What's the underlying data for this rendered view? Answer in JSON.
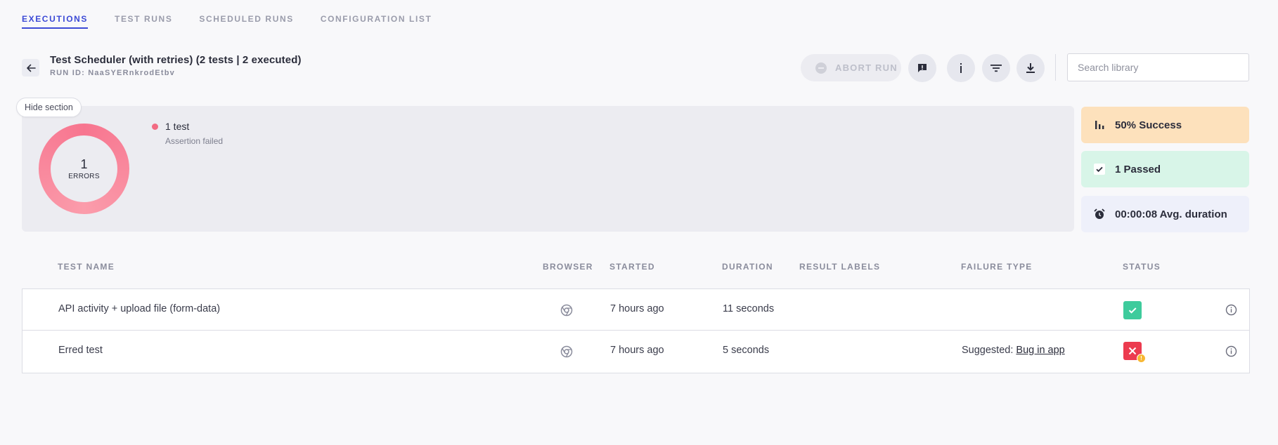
{
  "tabs": [
    {
      "label": "EXECUTIONS",
      "active": true
    },
    {
      "label": "TEST RUNS",
      "active": false
    },
    {
      "label": "SCHEDULED RUNS",
      "active": false
    },
    {
      "label": "CONFIGURATION LIST",
      "active": false
    }
  ],
  "header": {
    "title": "Test Scheduler (with retries) (2 tests | 2 executed)",
    "run_id": "RUN ID: NaaSYERnkrodEtbv"
  },
  "toolbar": {
    "abort_label": "ABORT RUN",
    "search_placeholder": "Search library"
  },
  "summary": {
    "hide_label": "Hide section",
    "donut_count": "1",
    "donut_label": "ERRORS",
    "legend_title": "1 test",
    "legend_sub": "Assertion failed",
    "error_color": "#f26b83"
  },
  "stats": {
    "success": "50% Success",
    "passed": "1 Passed",
    "duration": "00:00:08 Avg. duration"
  },
  "table": {
    "columns": [
      "TEST NAME",
      "BROWSER",
      "STARTED",
      "DURATION",
      "RESULT LABELS",
      "FAILURE TYPE",
      "STATUS"
    ],
    "rows": [
      {
        "name": "API activity + upload file (form-data)",
        "browser": "chrome-icon",
        "started": "7 hours ago",
        "duration": "11 seconds",
        "result_labels": "",
        "failure_prefix": "",
        "failure_link": "",
        "status": "passed"
      },
      {
        "name": "Erred test",
        "browser": "chrome-icon",
        "started": "7 hours ago",
        "duration": "5 seconds",
        "result_labels": "",
        "failure_prefix": "Suggested: ",
        "failure_link": "Bug in app",
        "status": "failed"
      }
    ]
  }
}
